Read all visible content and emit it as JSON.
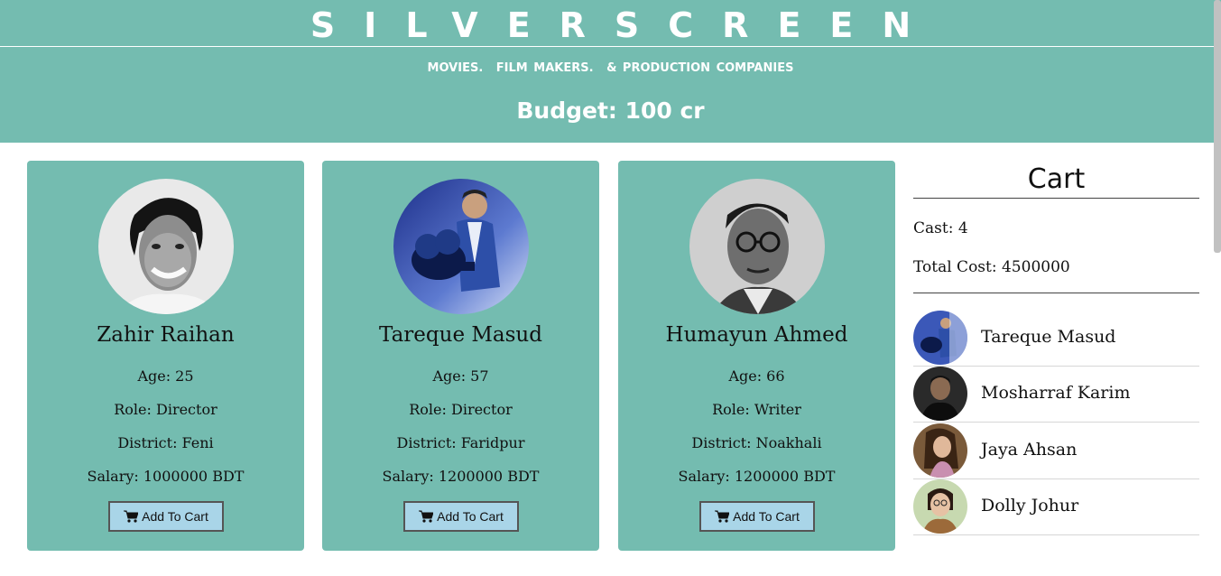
{
  "header": {
    "brand": "SILVERSCREEN",
    "tagline": [
      "MOVIES.",
      "FILM MAKERS.",
      "& PRODUCTION COMPANIES"
    ],
    "budget": "Budget: 100 cr"
  },
  "cards": [
    {
      "name": "Zahir Raihan",
      "age": "Age: 25",
      "role": "Role: Director",
      "district": "District: Feni",
      "salary": "Salary: 1000000 BDT",
      "button": "Add To Cart"
    },
    {
      "name": "Tareque Masud",
      "age": "Age: 57",
      "role": "Role: Director",
      "district": "District: Faridpur",
      "salary": "Salary: 1200000 BDT",
      "button": "Add To Cart"
    },
    {
      "name": "Humayun Ahmed",
      "age": "Age: 66",
      "role": "Role: Writer",
      "district": "District: Noakhali",
      "salary": "Salary: 1200000 BDT",
      "button": "Add To Cart"
    }
  ],
  "cart": {
    "title": "Cart",
    "cast": "Cast: 4",
    "total": "Total Cost: 4500000",
    "items": [
      {
        "name": "Tareque Masud"
      },
      {
        "name": "Mosharraf Karim"
      },
      {
        "name": "Jaya Ahsan"
      },
      {
        "name": "Dolly Johur"
      }
    ]
  },
  "colors": {
    "header_bg": "#74bcb0",
    "card_bg": "#74bcb0",
    "button_bg": "#a9d5e8"
  },
  "icons": {
    "cart_button": "shopping-cart-icon"
  }
}
